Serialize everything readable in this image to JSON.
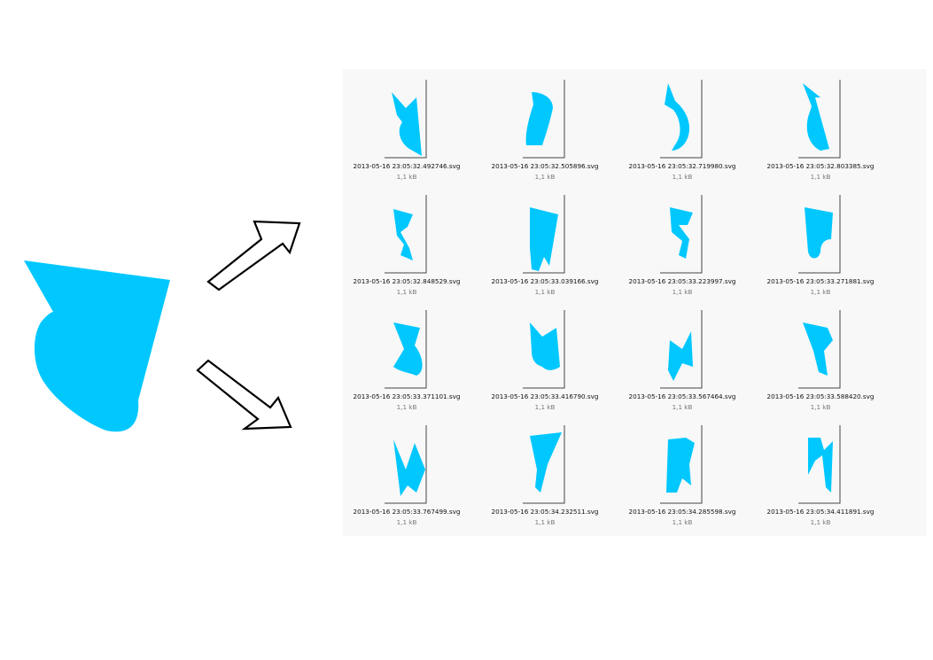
{
  "shape_color": "#00c8ff",
  "files": [
    {
      "name": "2013-05-16 23:05:32.492746.svg",
      "size": "1,1 kB"
    },
    {
      "name": "2013-05-16 23:05:32.505896.svg",
      "size": "1,1 kB"
    },
    {
      "name": "2013-05-16 23:05:32.719980.svg",
      "size": "1,1 kB"
    },
    {
      "name": "2013-05-16 23:05:32.803385.svg",
      "size": "1,1 kB"
    },
    {
      "name": "2013-05-16 23:05:32.848529.svg",
      "size": "1,1 kB"
    },
    {
      "name": "2013-05-16 23:05:33.039166.svg",
      "size": "1,1 kB"
    },
    {
      "name": "2013-05-16 23:05:33.223997.svg",
      "size": "1,1 kB"
    },
    {
      "name": "2013-05-16 23:05:33.271881.svg",
      "size": "1,1 kB"
    },
    {
      "name": "2013-05-16 23:05:33.371101.svg",
      "size": "1,1 kB"
    },
    {
      "name": "2013-05-16 23:05:33.416790.svg",
      "size": "1,1 kB"
    },
    {
      "name": "2013-05-16 23:05:33.567464.svg",
      "size": "1,1 kB"
    },
    {
      "name": "2013-05-16 23:05:33.588420.svg",
      "size": "1,1 kB"
    },
    {
      "name": "2013-05-16 23:05:33.767499.svg",
      "size": "1,1 kB"
    },
    {
      "name": "2013-05-16 23:05:34.232511.svg",
      "size": "1,1 kB"
    },
    {
      "name": "2013-05-16 23:05:34.285598.svg",
      "size": "1,1 kB"
    },
    {
      "name": "2013-05-16 23:05:34.411891.svg",
      "size": "1,1 kB"
    }
  ]
}
